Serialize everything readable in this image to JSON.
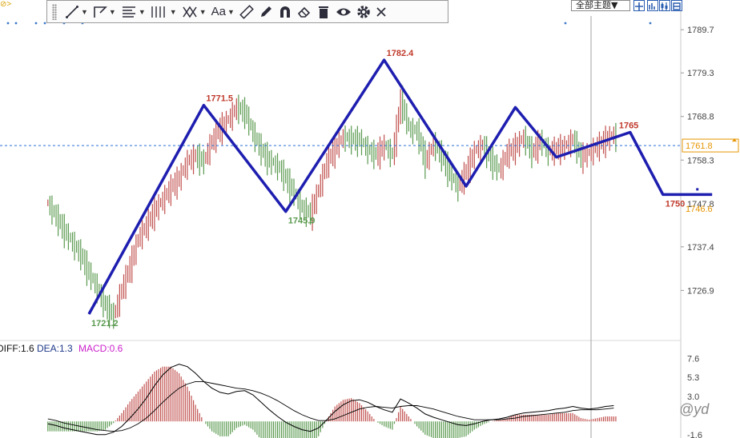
{
  "corner_label": "⊘>",
  "toolbar": {
    "items": [
      {
        "name": "line-tool",
        "icon": "line-icon",
        "caret": true
      },
      {
        "name": "polyline-tool",
        "icon": "polyline-icon",
        "caret": true
      },
      {
        "name": "fib-tool",
        "icon": "fibonacci-icon",
        "caret": true
      },
      {
        "name": "cycle-tool",
        "icon": "cycle-lines-icon",
        "caret": true
      },
      {
        "name": "pattern-tool",
        "icon": "pattern-icon",
        "caret": true
      },
      {
        "name": "text-tool",
        "icon": "text-icon",
        "label": "Aa",
        "caret": true
      },
      {
        "name": "ruler-tool",
        "icon": "ruler-icon"
      },
      {
        "name": "pen-tool",
        "icon": "pen-icon"
      },
      {
        "name": "magnet-tool",
        "icon": "magnet-icon"
      },
      {
        "name": "eraser-tool",
        "icon": "eraser-icon"
      },
      {
        "name": "delete-tool",
        "icon": "trash-icon"
      },
      {
        "name": "visibility-tool",
        "icon": "eye-icon"
      },
      {
        "name": "settings-tool",
        "icon": "gear-icon"
      },
      {
        "name": "close-tool",
        "icon": "close-icon"
      }
    ]
  },
  "theme_select": {
    "label": "全部主题▼"
  },
  "watermark": "@yd",
  "colors": {
    "up": "#c0504d",
    "down": "#5a9a4f",
    "wave": "#1e1eb0",
    "axis_text": "#444444",
    "current_price": "#e69500",
    "macd_label": "#cc22cc",
    "dea_label": "#1f3a8a"
  },
  "chart_data": {
    "type": "line",
    "price_axis": {
      "ticks": [
        1789.7,
        1779.3,
        1768.8,
        1758.3,
        1747.8,
        1737.4,
        1726.9
      ],
      "ylim": [
        1716,
        1793
      ]
    },
    "current_price": 1761.8,
    "marked_price": 1746.6,
    "wave_line": {
      "x": [
        0,
        14,
        24,
        36,
        46,
        52,
        57,
        66,
        70,
        76
      ],
      "y": [
        1721.2,
        1771.5,
        1745.9,
        1782.4,
        1752.0,
        1771.0,
        1759.0,
        1765.0,
        1750.0,
        1750.0
      ],
      "labels": [
        {
          "index": 0,
          "text": "1721.2"
        },
        {
          "index": 1,
          "text": "1771.5"
        },
        {
          "index": 2,
          "text": "1745.9"
        },
        {
          "index": 3,
          "text": "1782.4"
        },
        {
          "index": 7,
          "text": "1765"
        },
        {
          "index": 8,
          "text": "1750"
        }
      ]
    },
    "candles": {
      "x_start": -5,
      "close": [
        1748.2,
        1745.1,
        1741.7,
        1738.7,
        1736.0,
        1731.5,
        1727.7,
        1723.7,
        1721.2,
        1727.7,
        1733.3,
        1739.9,
        1743.1,
        1746.7,
        1749.2,
        1752.3,
        1754.5,
        1758.4,
        1759.9,
        1758.4,
        1763.5,
        1766.6,
        1768.5,
        1771.5,
        1770.4,
        1765.1,
        1761.2,
        1758.6,
        1757.3,
        1754.4,
        1750.8,
        1747.0,
        1745.9,
        1751.8,
        1758.3,
        1761.7,
        1764.3,
        1763.9,
        1763.6,
        1761.2,
        1760.1,
        1762.3,
        1759.9,
        1773.5,
        1766.2,
        1765.8,
        1758.4,
        1762.7,
        1759.8,
        1755.3,
        1752.2,
        1756.3,
        1760.8,
        1762.4,
        1758.8,
        1756.3,
        1760.5,
        1762.1,
        1764.2,
        1760.6,
        1763.5,
        1760.8,
        1761.6,
        1762.0,
        1763.8,
        1759.6,
        1760.5,
        1762.2,
        1763.8,
        1764.9,
        1761.8
      ]
    },
    "macd": {
      "labels": {
        "diff": "DIFF:1.6",
        "dea": "DEA:1.3",
        "macd": "MACD:0.6"
      },
      "axis_ticks": [
        7.6,
        5.3,
        3.0,
        -1.6
      ],
      "ylim": [
        -2.0,
        8.4
      ],
      "diff": [
        -0.3,
        -0.5,
        -0.8,
        -1.0,
        -1.2,
        -1.4,
        -1.6,
        -1.6,
        -1.3,
        -0.6,
        0.4,
        1.5,
        2.8,
        4.3,
        5.6,
        6.5,
        6.9,
        6.6,
        5.8,
        4.8,
        4.0,
        3.5,
        3.3,
        3.6,
        3.7,
        3.2,
        2.3,
        1.4,
        0.6,
        -0.1,
        -0.6,
        -1.0,
        -1.2,
        -0.8,
        0.2,
        1.2,
        2.0,
        2.5,
        2.6,
        2.3,
        1.8,
        1.4,
        1.1,
        2.7,
        2.2,
        1.6,
        0.9,
        0.5,
        0.2,
        -0.1,
        -0.4,
        -0.5,
        -0.3,
        0.0,
        0.2,
        0.3,
        0.5,
        0.8,
        1.0,
        1.1,
        1.2,
        1.3,
        1.5,
        1.6,
        1.8,
        1.6,
        1.5,
        1.6,
        1.8,
        1.9,
        1.6
      ],
      "dea": [
        0.3,
        0.1,
        -0.2,
        -0.4,
        -0.6,
        -0.8,
        -1.0,
        -1.1,
        -1.2,
        -1.1,
        -0.8,
        -0.3,
        0.4,
        1.3,
        2.3,
        3.2,
        4.0,
        4.5,
        4.8,
        4.8,
        4.6,
        4.4,
        4.2,
        4.0,
        3.9,
        3.7,
        3.4,
        3.0,
        2.5,
        1.9,
        1.3,
        0.8,
        0.4,
        0.1,
        0.1,
        0.3,
        0.7,
        1.1,
        1.5,
        1.7,
        1.8,
        1.7,
        1.6,
        1.8,
        1.9,
        1.9,
        1.7,
        1.5,
        1.2,
        0.9,
        0.6,
        0.4,
        0.2,
        0.2,
        0.2,
        0.2,
        0.3,
        0.4,
        0.6,
        0.7,
        0.8,
        0.9,
        1.0,
        1.1,
        1.3,
        1.4,
        1.4,
        1.4,
        1.5,
        1.6,
        1.3
      ]
    }
  }
}
